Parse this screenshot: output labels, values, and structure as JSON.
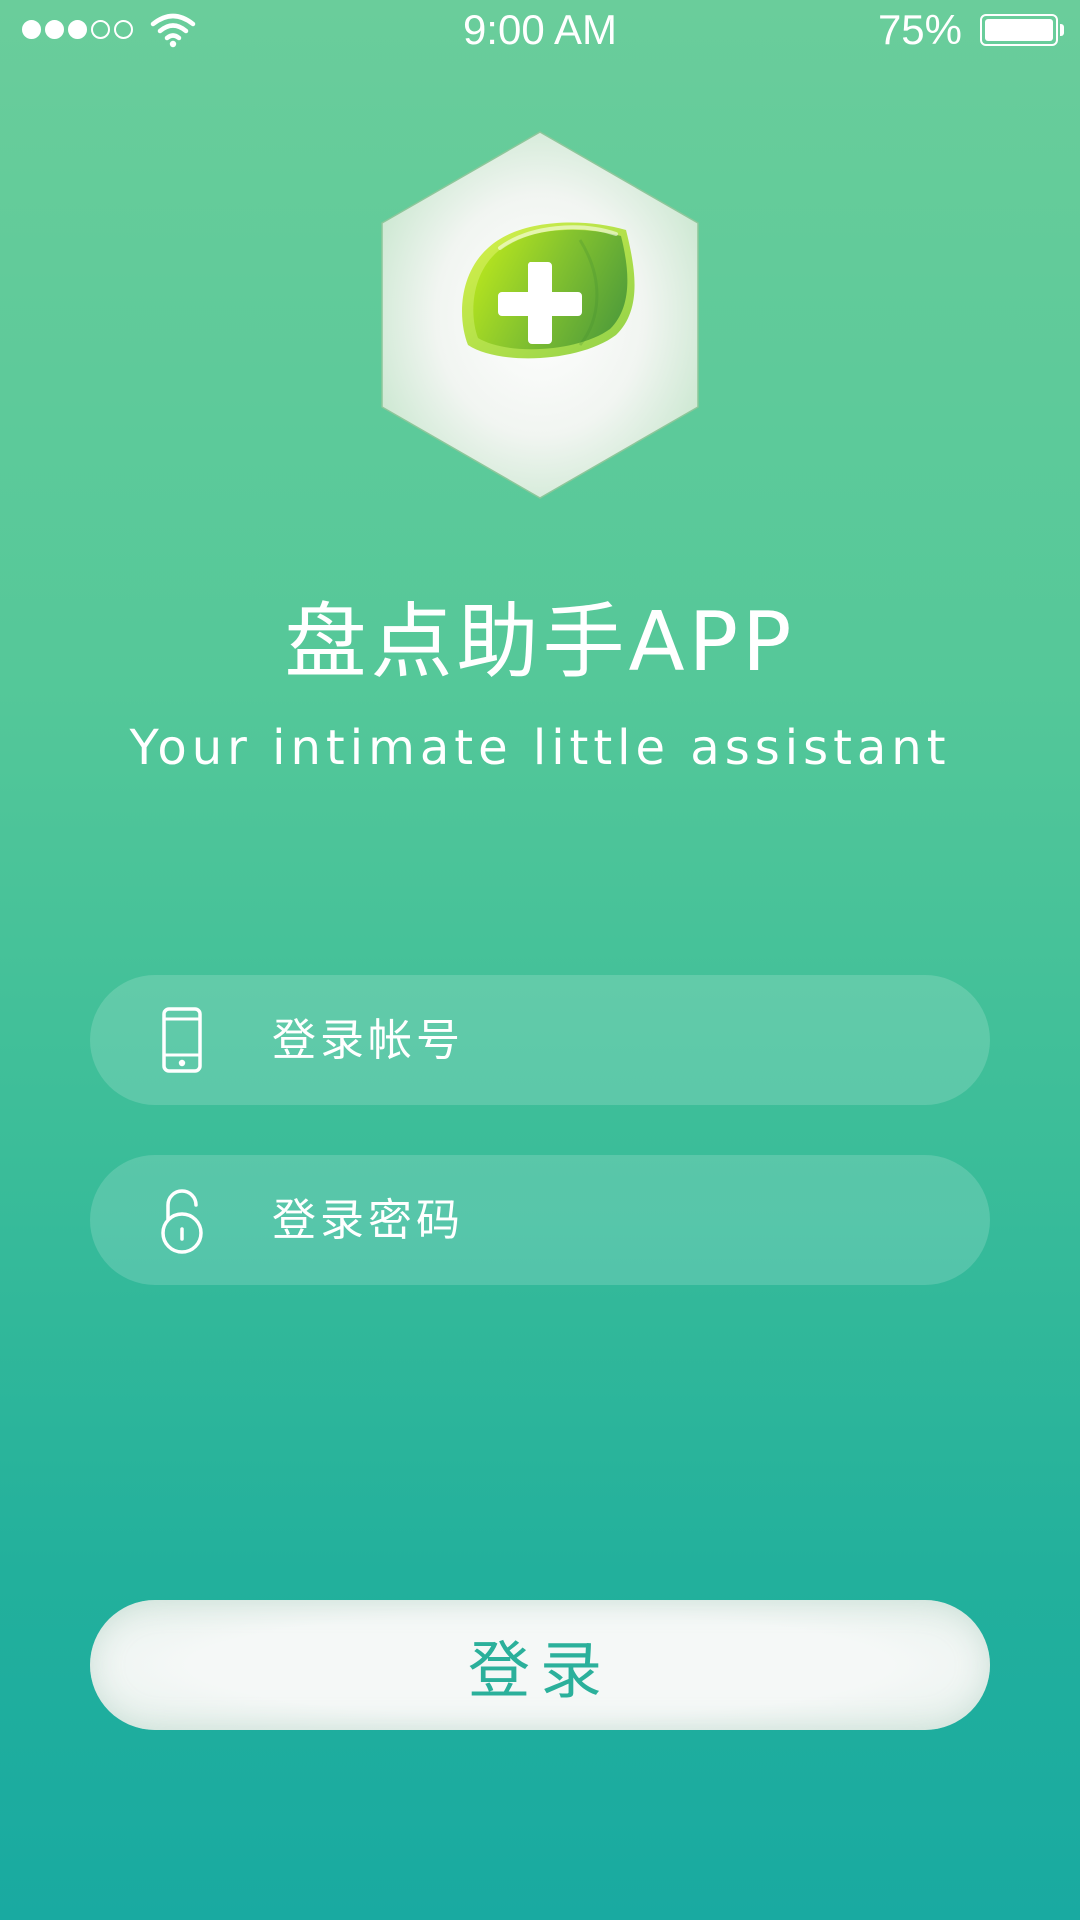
{
  "status_bar": {
    "time": "9:00 AM",
    "battery_percent": "75%",
    "signal_bars_filled": 3,
    "signal_bars_total": 5,
    "battery_level": 1.0
  },
  "logo": {
    "icon": "green-leaf-plus-icon"
  },
  "header": {
    "title": "盘点助手APP",
    "subtitle": "Your intimate little assistant"
  },
  "form": {
    "account": {
      "placeholder": "登录帐号",
      "value": "",
      "icon": "phone-icon"
    },
    "password": {
      "placeholder": "登录密码",
      "value": "",
      "icon": "unlock-icon"
    },
    "login_label": "登录"
  },
  "colors": {
    "background_top": "#6acd9b",
    "background_bottom": "#19aaa1",
    "button_text": "#2bb09b",
    "leaf_light": "#a9dc2a",
    "leaf_dark": "#5aa83a"
  }
}
